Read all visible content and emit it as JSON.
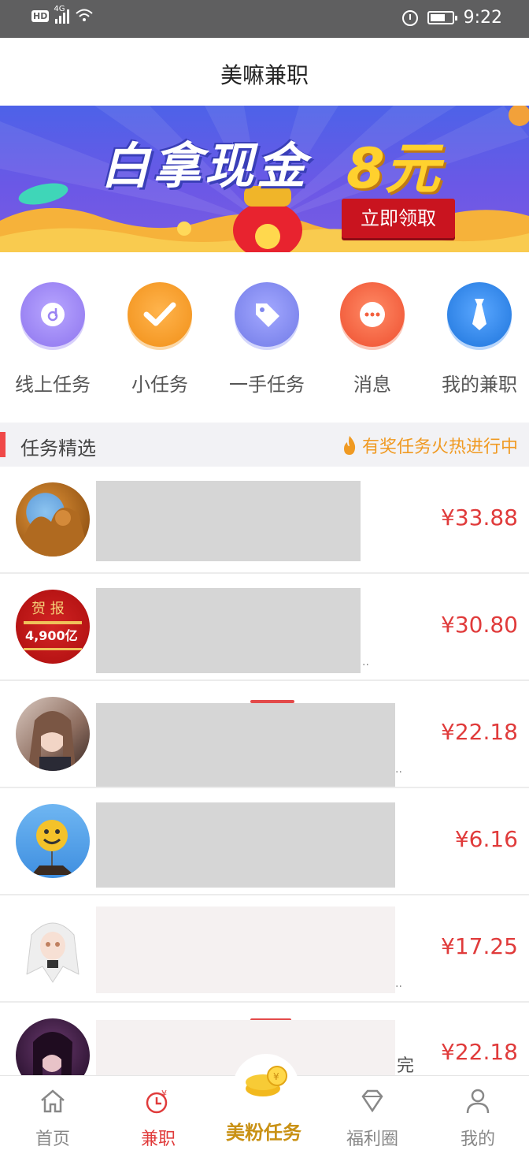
{
  "status_bar": {
    "network": "4G",
    "hd": "HD",
    "time": "9:22"
  },
  "header": {
    "title": "美嘛兼职"
  },
  "banner": {
    "headline": "白拿现金",
    "amount": "8元",
    "cta": "立即领取"
  },
  "categories": [
    {
      "label": "线上任务",
      "icon": "disc-icon",
      "color": "#a08cf5"
    },
    {
      "label": "小任务",
      "icon": "checkmark-icon",
      "color": "#f59a27"
    },
    {
      "label": "一手任务",
      "icon": "tag-icon",
      "color": "#8c92f2"
    },
    {
      "label": "消息",
      "icon": "chat-bubble-icon",
      "color": "#f46a4a"
    },
    {
      "label": "我的兼职",
      "icon": "tie-icon",
      "color": "#3a8de8"
    }
  ],
  "section": {
    "title": "任务精选",
    "promo": "有奖任务火热进行中"
  },
  "tasks": [
    {
      "price": "¥33.88"
    },
    {
      "price": "¥30.80"
    },
    {
      "price": "¥22.18"
    },
    {
      "price": "¥6.16"
    },
    {
      "price": "¥17.25"
    },
    {
      "price": "¥22.18",
      "extra": "完"
    }
  ],
  "tabs": [
    {
      "label": "首页",
      "icon": "home-icon"
    },
    {
      "label": "兼职",
      "icon": "clock-yuan-icon"
    },
    {
      "label": "美粉任务",
      "icon": "coins-icon"
    },
    {
      "label": "福利圈",
      "icon": "diamond-icon"
    },
    {
      "label": "我的",
      "icon": "person-icon"
    }
  ],
  "colors": {
    "accent": "#e03b3b",
    "orange": "#f09a22",
    "statusbar": "#5f5f60"
  }
}
